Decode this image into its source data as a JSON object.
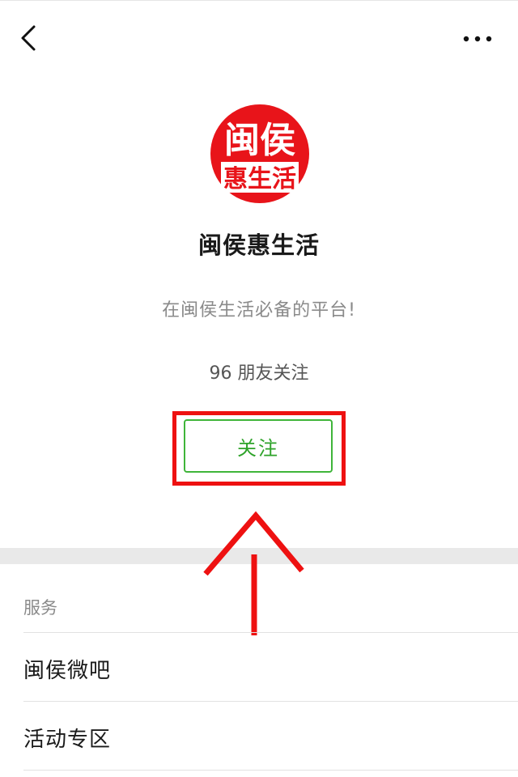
{
  "nav": {
    "back_icon": "chevron-left-icon",
    "more_icon": "ellipsis-icon"
  },
  "profile": {
    "logo_text_top": "闽侯",
    "logo_text_bottom": "惠生活",
    "name": "闽侯惠生活",
    "description": "在闽侯生活必备的平台!",
    "followers": "96 朋友关注",
    "follow_label": "关注"
  },
  "services": {
    "header": "服务",
    "items": [
      {
        "label": "闽侯微吧"
      },
      {
        "label": "活动专区"
      }
    ]
  },
  "colors": {
    "highlight": "#ee1111",
    "follow_green": "#2ea32a",
    "logo_red": "#e8141a"
  }
}
